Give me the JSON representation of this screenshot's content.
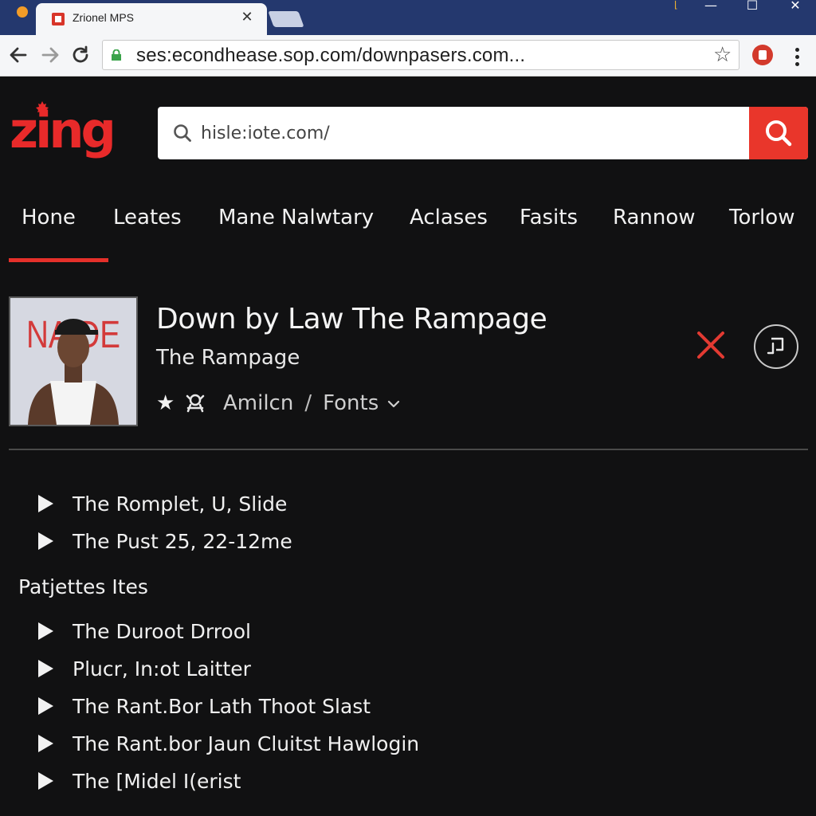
{
  "browser": {
    "tab_title": "Zrionel MPS",
    "tab_close": "✕",
    "url": "ses:econdhease.sop.com/downpasers.com...",
    "window_controls": {
      "minimize": "—",
      "maximize": "☐",
      "close": "✕"
    }
  },
  "site": {
    "logo": "zing",
    "search": {
      "placeholder": "hisle:iote.com/",
      "value": ""
    }
  },
  "nav": {
    "items": [
      {
        "label": "Hone",
        "active": true
      },
      {
        "label": "Leates"
      },
      {
        "label": "Mane Nalwtary"
      },
      {
        "label": "Aclases"
      },
      {
        "label": "Fasits"
      },
      {
        "label": "Rannow"
      },
      {
        "label": "Torlow"
      }
    ]
  },
  "track": {
    "cover_text": "NAIDE",
    "title": "Down by Law The Rampage",
    "subtitle": "The Rampage",
    "genre": "Amilcn",
    "separator": "/",
    "category": "Fonts",
    "star_glyph": "★"
  },
  "lists": {
    "top_items": [
      "The Romplet, U, Slide",
      "The Pust 25, 22-12me"
    ],
    "section_title": "Patjettes Ites",
    "section_items": [
      "The Duroot Drrool",
      "Plucr, In:ot Laitter",
      "The Rant.Bor Lath Thoot Slast",
      "The Rant.bor Jaun Cluitst Hawlogin",
      "The [Midel I(erist"
    ]
  },
  "colors": {
    "accent": "#e82a2a",
    "background": "#111112",
    "titlebar": "#24386e"
  },
  "icons": [
    "search-icon",
    "close-icon",
    "playlist-icon",
    "star-icon",
    "play-icon",
    "chevron-down-icon",
    "lock-icon",
    "bookmark-star-icon",
    "back-arrow-icon",
    "forward-arrow-icon",
    "reload-icon"
  ]
}
